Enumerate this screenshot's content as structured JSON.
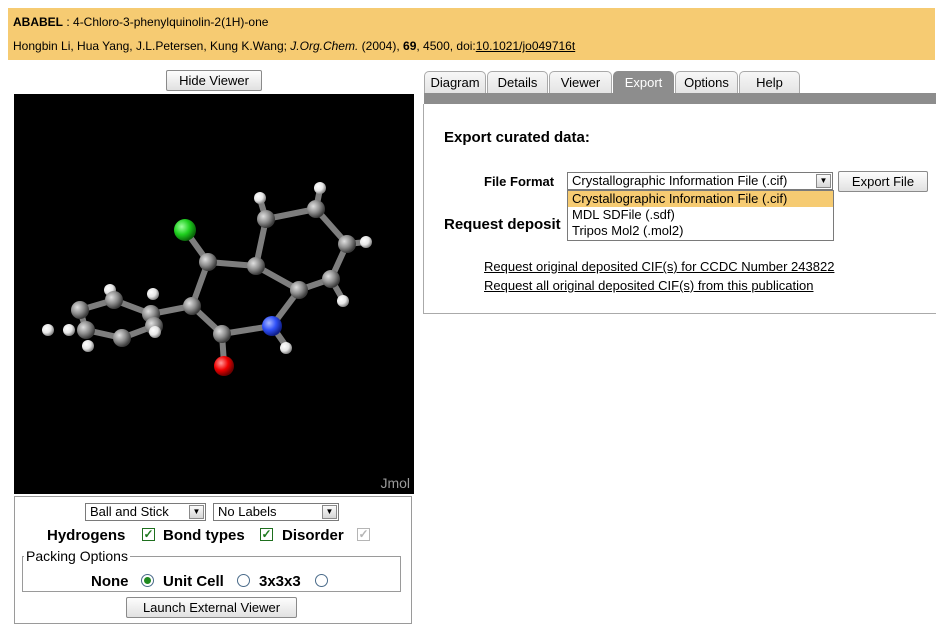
{
  "header": {
    "refcode": "ABABEL",
    "separator": " : ",
    "compound": "4-Chloro-3-phenylquinolin-2(1H)-one",
    "authors": "Hongbin Li, Hua Yang, J.L.Petersen, Kung K.Wang; ",
    "journal": "J.Org.Chem.",
    "year_text": " (2004), ",
    "volume": "69",
    "pages_text": ", 4500, doi:",
    "doi": "10.1021/jo049716t"
  },
  "viewer": {
    "hide_button": "Hide Viewer",
    "watermark": "Jmol",
    "style_select": "Ball and Stick",
    "labels_select": "No Labels",
    "hydrogens_label": "Hydrogens",
    "bond_types_label": "Bond types",
    "disorder_label": "Disorder",
    "hydrogens_checked": true,
    "bond_types_checked": true,
    "disorder_checked": true,
    "packing_legend": "Packing Options",
    "packing_none": "None",
    "packing_unit_cell": "Unit Cell",
    "packing_3x3x3": "3x3x3",
    "packing_selected": "None",
    "launch_button": "Launch External Viewer"
  },
  "tabs": [
    {
      "label": "Diagram"
    },
    {
      "label": "Details"
    },
    {
      "label": "Viewer"
    },
    {
      "label": "Export"
    },
    {
      "label": "Options"
    },
    {
      "label": "Help"
    }
  ],
  "active_tab": "Export",
  "export": {
    "heading": "Export curated data:",
    "file_format_label": "File Format",
    "selected_format": "Crystallographic Information File (.cif)",
    "export_button": "Export File",
    "request_heading": "Request deposit",
    "format_options": [
      "Crystallographic Information File (.cif)",
      "MDL SDFile (.sdf)",
      "Tripos Mol2 (.mol2)"
    ],
    "link_ccdc": "Request original deposited CIF(s) for CCDC Number 243822",
    "link_publication": "Request all original deposited CIF(s) from this publication"
  },
  "colors": {
    "header_bg": "#f6cb72",
    "tab_active": "#8d8d8d",
    "highlight": "#f6cb72",
    "chlorine": "#1fd01f",
    "nitrogen": "#2f50f8",
    "oxygen": "#f00000",
    "carbon": "#909090",
    "hydrogen": "#ffffff"
  }
}
